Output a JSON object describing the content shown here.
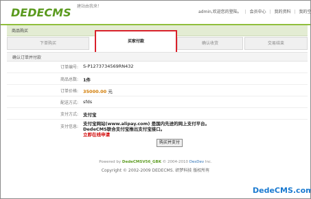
{
  "header": {
    "logo_main": "DEDE",
    "logo_cms": "CMS",
    "slogan": "建站由我来！",
    "user_greeting": "admin,欢迎您的登陆。",
    "links": [
      "会员中心",
      "我的资料",
      "我的空间"
    ]
  },
  "page_title": "商品购买",
  "steps": [
    {
      "label": "下单购买"
    },
    {
      "label": "买家付款"
    },
    {
      "label": "确认收货"
    },
    {
      "label": "交易结束"
    }
  ],
  "section_title": "确认订单并付款",
  "order": {
    "number_label": "订单编号:",
    "number_value": "S-P1273734569RN432",
    "goods_label": "商品总数:",
    "goods_value": "1件",
    "price_label": "订单价格:",
    "price_value": "35000.00",
    "price_unit": "元",
    "delivery_label": "配送方式:",
    "delivery_value": "sfds",
    "payment_label": "支付方式:",
    "payment_value": "支付宝",
    "info_label": "支付信息:",
    "info_line1": "支付宝网站(www.alipay.com) 是国内先进的网上支付平台。",
    "info_line2": "DedeCMS联合支付宝推出支付宝接口。",
    "info_line3": "立即在线申请"
  },
  "submit_label": "购买并支付",
  "footer": {
    "powered_prefix": "Powered by",
    "powered_product": "DedeCMSV56_GBK",
    "powered_mid": "© 2004-2010",
    "powered_company": "DesDev",
    "powered_suffix": "Inc.",
    "copyright": "Copyright © 2002-2009 DEDECMS. 织梦科技 版权所有"
  },
  "watermark": "DedeCMS.com",
  "colors": {
    "brand_green": "#5a9a1e",
    "highlight_red": "#d9202a",
    "price_orange": "#d17a00",
    "watermark_blue": "#1a7ad0"
  }
}
